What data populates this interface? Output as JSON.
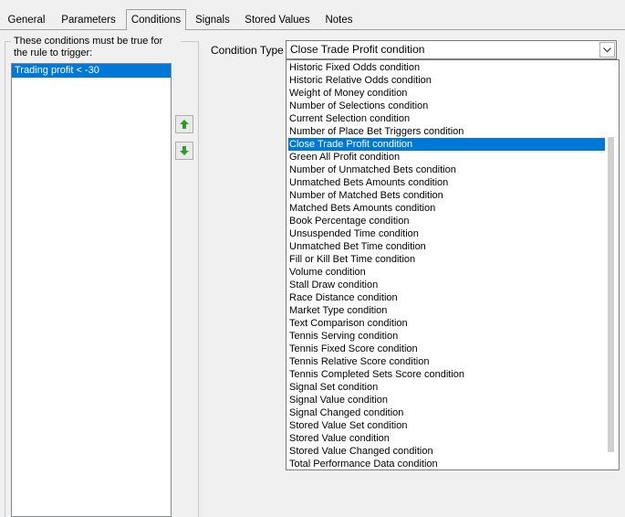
{
  "tabs": [
    {
      "label": "General",
      "active": false
    },
    {
      "label": "Parameters",
      "active": false
    },
    {
      "label": "Conditions",
      "active": true
    },
    {
      "label": "Signals",
      "active": false
    },
    {
      "label": "Stored Values",
      "active": false
    },
    {
      "label": "Notes",
      "active": false
    }
  ],
  "conditions_group": {
    "label": "These conditions must be true for the rule to trigger:",
    "items": [
      "Trading profit < -30"
    ]
  },
  "condition_type": {
    "label": "Condition Type",
    "selected": "Close Trade Profit condition",
    "options": [
      "Historic Fixed Odds condition",
      "Historic Relative Odds condition",
      "Weight of Money condition",
      "Number of Selections condition",
      "Current Selection condition",
      "Number of Place Bet Triggers condition",
      "Close Trade Profit condition",
      "Green All Profit condition",
      "Number of Unmatched Bets condition",
      "Unmatched Bets Amounts condition",
      "Number of Matched Bets condition",
      "Matched Bets Amounts condition",
      "Book Percentage condition",
      "Unsuspended Time condition",
      "Unmatched Bet Time condition",
      "Fill or Kill Bet Time condition",
      "Volume condition",
      "Stall Draw condition",
      "Race Distance condition",
      "Market Type condition",
      "Text Comparison condition",
      "Tennis Serving condition",
      "Tennis Fixed Score condition",
      "Tennis Relative Score condition",
      "Tennis Completed Sets Score condition",
      "Signal Set condition",
      "Signal Value condition",
      "Signal Changed condition",
      "Stored Value Set condition",
      "Stored Value condition",
      "Stored Value Changed condition",
      "Total Performance Data condition"
    ]
  },
  "icons": {
    "move_up": "green-up-arrow-icon",
    "move_down": "green-down-arrow-icon",
    "dropdown": "chevron-down-icon"
  },
  "colors": {
    "selection": "#0078d7",
    "arrow_green": "#2e9b2e"
  }
}
